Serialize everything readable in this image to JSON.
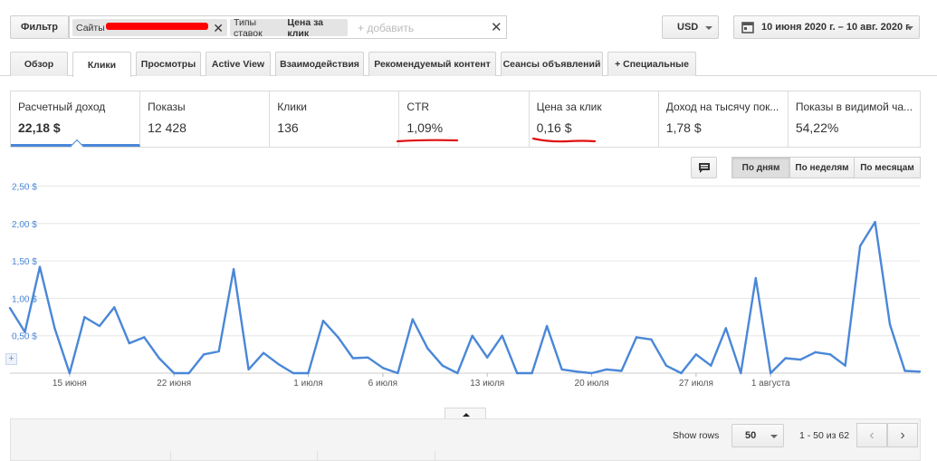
{
  "filter_bar": {
    "filter_label": "Фильтр",
    "sites_chip_label": "Сайты",
    "bid_chip_prefix": "Типы ставок",
    "bid_chip_value": "Цена за клик",
    "add_placeholder": "+ добавить",
    "currency": "USD",
    "date_range": "10 июня 2020 г. – 10 авг. 2020 г."
  },
  "tabs": [
    {
      "label": "Обзор"
    },
    {
      "label": "Клики"
    },
    {
      "label": "Просмотры"
    },
    {
      "label": "Active View"
    },
    {
      "label": "Взаимодействия"
    },
    {
      "label": "Рекомендуемый контент"
    },
    {
      "label": "Сеансы объявлений"
    },
    {
      "label": "+ Специальные"
    }
  ],
  "metrics": [
    {
      "label": "Расчетный доход",
      "value": "22,18 $"
    },
    {
      "label": "Показы",
      "value": "12 428"
    },
    {
      "label": "Клики",
      "value": "136"
    },
    {
      "label": "CTR",
      "value": "1,09%"
    },
    {
      "label": "Цена за клик",
      "value": "0,16 $"
    },
    {
      "label": "Доход на тысячу пок...",
      "value": "1,78 $"
    },
    {
      "label": "Показы в видимой ча...",
      "value": "54,22%"
    }
  ],
  "granularity": {
    "day": "По дням",
    "week": "По неделям",
    "month": "По месяцам"
  },
  "footer": {
    "show_rows_label": "Show rows",
    "rows_value": "50",
    "range_text": "1 - 50 из 62"
  },
  "colors": {
    "line": "#4a87d8",
    "annotation": "#e01010"
  },
  "chart_data": {
    "type": "line",
    "title": "",
    "xlabel": "",
    "ylabel": "",
    "ylim": [
      0,
      2.5
    ],
    "yticks": [
      "0,50 $",
      "1,00 $",
      "1,50 $",
      "2,00 $",
      "2,50 $"
    ],
    "ytick_values": [
      0.5,
      1.0,
      1.5,
      2.0,
      2.5
    ],
    "xticks": [
      {
        "label": "15 июня",
        "index": 4
      },
      {
        "label": "22 июня",
        "index": 11
      },
      {
        "label": "1 июля",
        "index": 20
      },
      {
        "label": "6 июля",
        "index": 25
      },
      {
        "label": "13 июля",
        "index": 32
      },
      {
        "label": "20 июля",
        "index": 39
      },
      {
        "label": "27 июля",
        "index": 46
      },
      {
        "label": "1 августа",
        "index": 51
      }
    ],
    "grid": true,
    "series": [
      {
        "values": [
          0.87,
          0.55,
          1.42,
          0.6,
          0.0,
          0.75,
          0.63,
          0.88,
          0.4,
          0.48,
          0.2,
          0.0,
          0.0,
          0.25,
          0.29,
          1.39,
          0.05,
          0.27,
          0.12,
          0.0,
          0.0,
          0.7,
          0.48,
          0.2,
          0.21,
          0.07,
          0.0,
          0.72,
          0.33,
          0.1,
          0.0,
          0.5,
          0.21,
          0.5,
          0.0,
          0.0,
          0.63,
          0.05,
          0.02,
          0.0,
          0.05,
          0.03,
          0.48,
          0.45,
          0.1,
          0.0,
          0.25,
          0.1,
          0.6,
          0.0,
          1.27,
          0.0,
          0.2,
          0.18,
          0.28,
          0.25,
          0.1,
          1.7,
          2.02,
          0.65,
          0.03,
          0.02
        ]
      }
    ]
  }
}
